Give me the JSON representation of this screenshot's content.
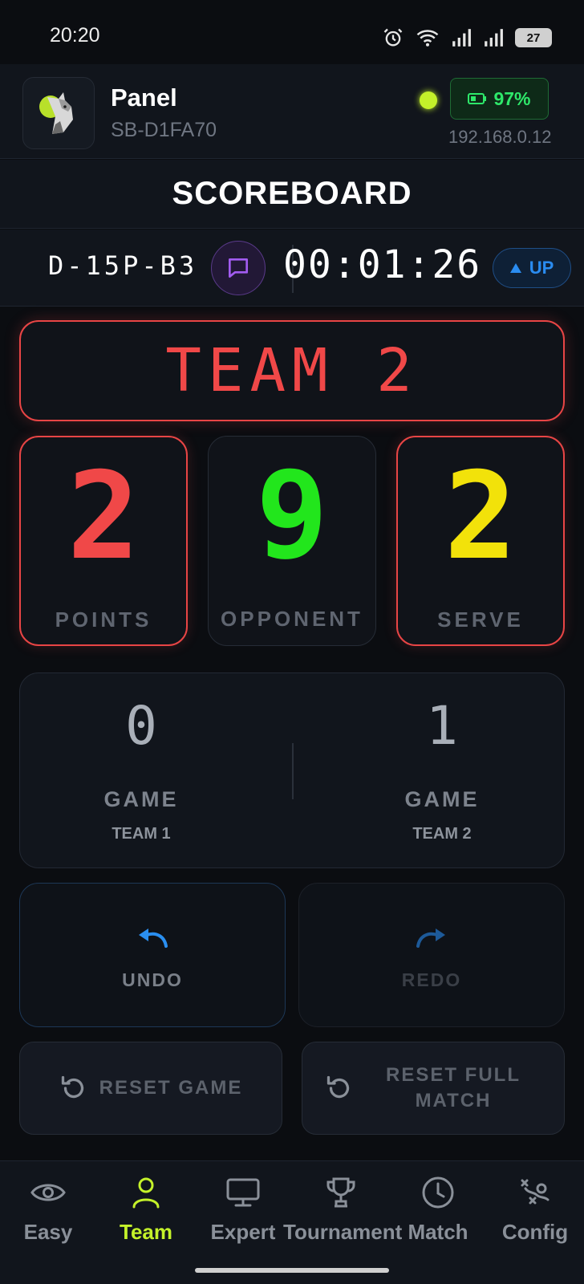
{
  "status": {
    "time": "20:20",
    "battery": "27"
  },
  "header": {
    "title": "Panel",
    "device_id": "SB-D1FA70",
    "battery": "97%",
    "ip": "192.168.0.12",
    "online_color": "#c4f12a"
  },
  "page_title": "SCOREBOARD",
  "info": {
    "match_code": "D-15P-B3",
    "timer": "00:01:26",
    "direction": "UP"
  },
  "team_banner": "TEAM 2",
  "scores": {
    "points": {
      "value": "2",
      "label": "POINTS",
      "color": "#f04848"
    },
    "opponent": {
      "value": "9",
      "label": "OPPONENT",
      "color": "#22e61c"
    },
    "serve": {
      "value": "2",
      "label": "SERVE",
      "color": "#f2e20a"
    }
  },
  "games": {
    "team1": {
      "value": "0",
      "label": "GAME",
      "team": "TEAM 1"
    },
    "team2": {
      "value": "1",
      "label": "GAME",
      "team": "TEAM 2"
    }
  },
  "actions": {
    "undo": "UNDO",
    "redo": "REDO",
    "reset_game": "RESET GAME",
    "reset_full_line1": "RESET FULL",
    "reset_full_line2": "MATCH"
  },
  "nav": [
    {
      "label": "Easy",
      "icon": "eye-icon"
    },
    {
      "label": "Team",
      "icon": "user-icon",
      "active": true
    },
    {
      "label": "Expert",
      "icon": "monitor-icon"
    },
    {
      "label": "Tournament",
      "icon": "trophy-icon"
    },
    {
      "label": "Match",
      "icon": "clock-icon"
    },
    {
      "label": "Config",
      "icon": "settings-icon"
    }
  ]
}
